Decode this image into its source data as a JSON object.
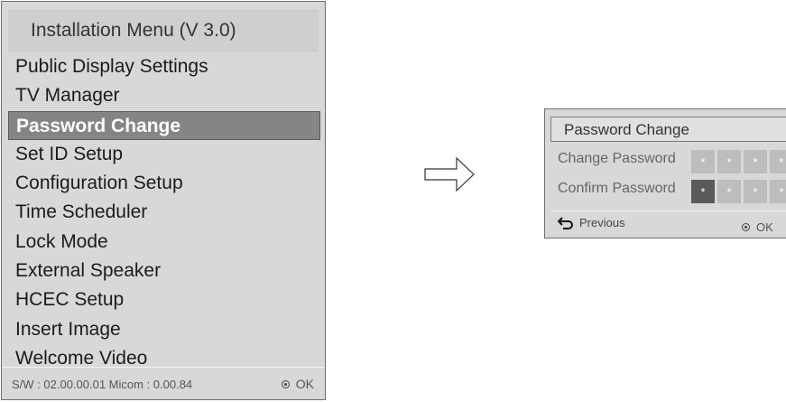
{
  "menu": {
    "title": "Installation Menu (V 3.0)",
    "items": [
      {
        "label": "Public Display Settings"
      },
      {
        "label": "TV Manager"
      },
      {
        "label": "Password Change",
        "selected": true
      },
      {
        "label": "Set ID Setup"
      },
      {
        "label": "Configuration Setup"
      },
      {
        "label": "Time Scheduler"
      },
      {
        "label": "Lock Mode"
      },
      {
        "label": "External Speaker"
      },
      {
        "label": "HCEC Setup"
      },
      {
        "label": "Insert Image"
      },
      {
        "label": "Welcome Video"
      }
    ],
    "footer_info": "S/W : 02.00.00.01 Micom : 0.00.84",
    "ok_label": "OK"
  },
  "dialog": {
    "title": "Password Change",
    "change_label": "Change Password",
    "confirm_label": "Confirm Password",
    "mask_char": "*",
    "previous_label": "Previous",
    "ok_label": "OK"
  },
  "colors": {
    "panel_bg": "#d8d8d8",
    "selected_bg": "#858585",
    "active_box": "#5a5a5a",
    "inactive_box": "#bdbdbd"
  },
  "icons": [
    "ok-icon",
    "back-arrow-icon",
    "right-arrow-icon"
  ]
}
